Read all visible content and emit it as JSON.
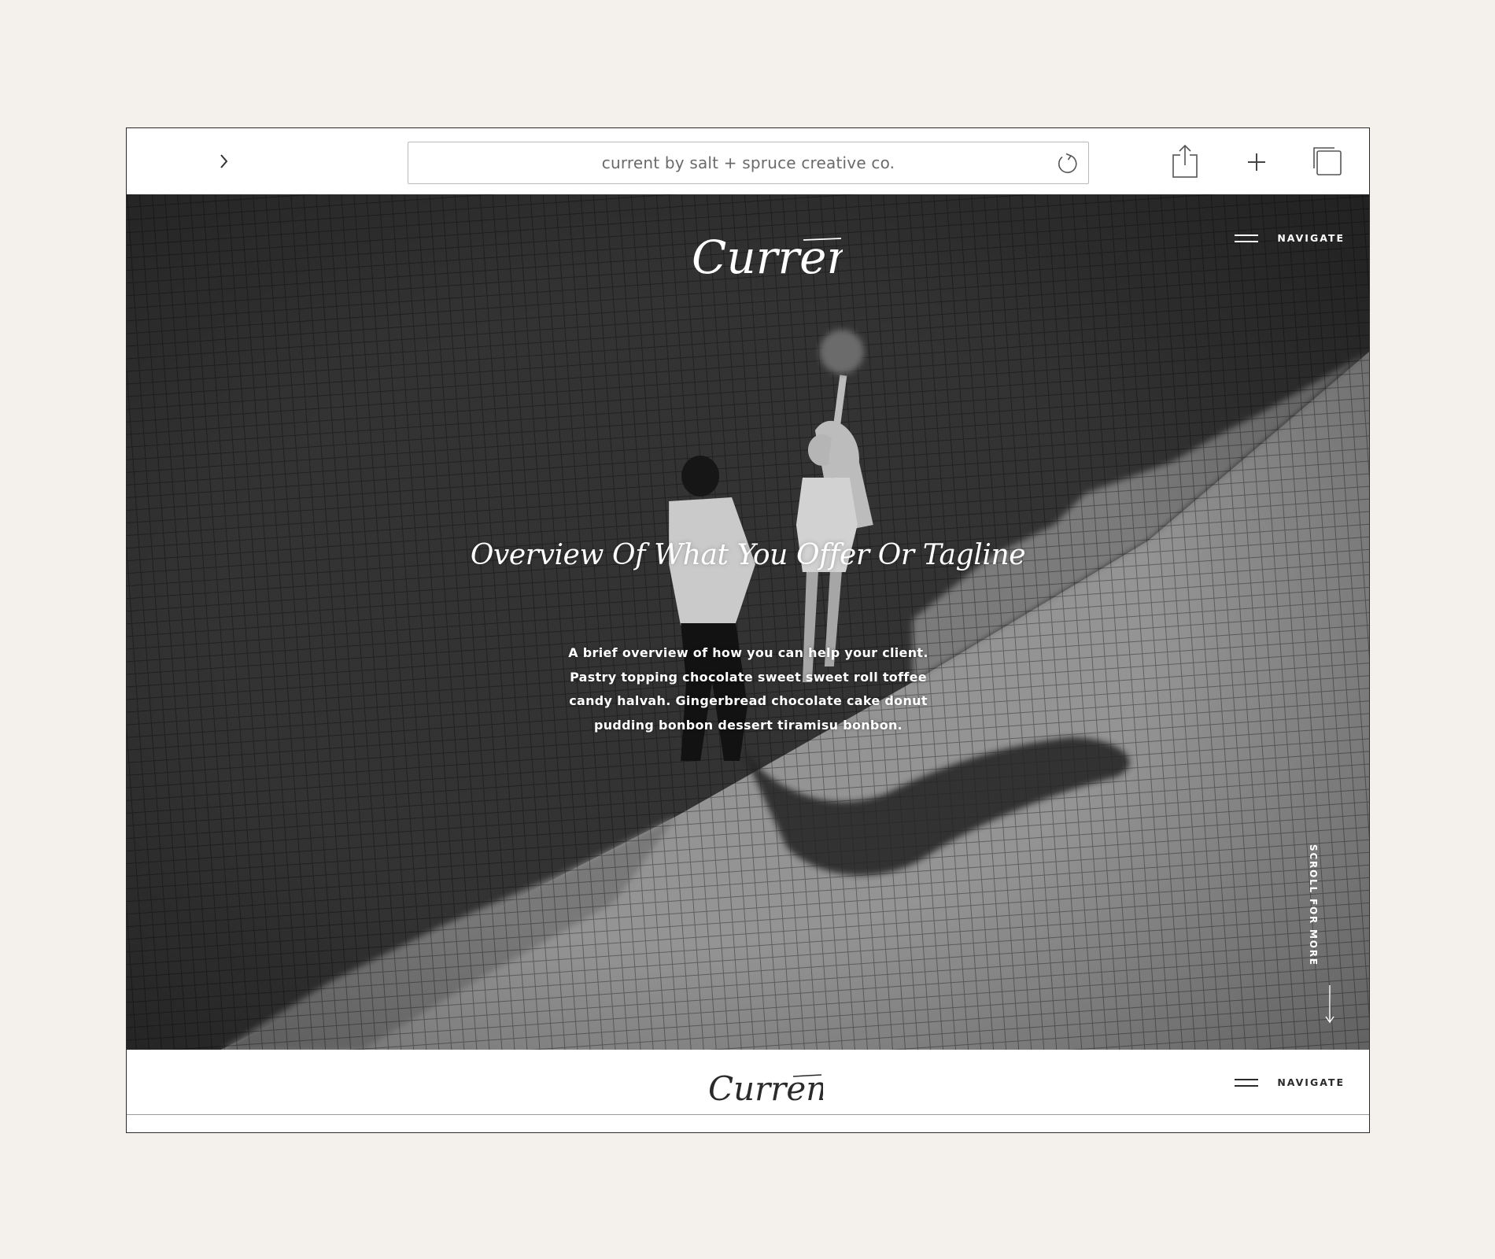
{
  "browser": {
    "url_text": "current by salt + spruce creative co."
  },
  "site": {
    "brand": "Current",
    "nav_label": "NAVIGATE"
  },
  "hero": {
    "title": "Overview Of What You Offer Or Tagline",
    "description": "A brief overview of how you can help your client. Pastry topping chocolate sweet sweet roll toffee candy halvah. Gingerbread chocolate cake donut pudding bonbon dessert tiramisu bonbon.",
    "scroll_label": "SCROLL FOR MORE",
    "photo_icon": "black-and-white-photo-couple-walking-icon"
  },
  "colors": {
    "page_bg": "#f4f1ec",
    "window_bg": "#ffffff",
    "hero_text": "#ffffff",
    "nav_dark": "#2a2a2a"
  }
}
